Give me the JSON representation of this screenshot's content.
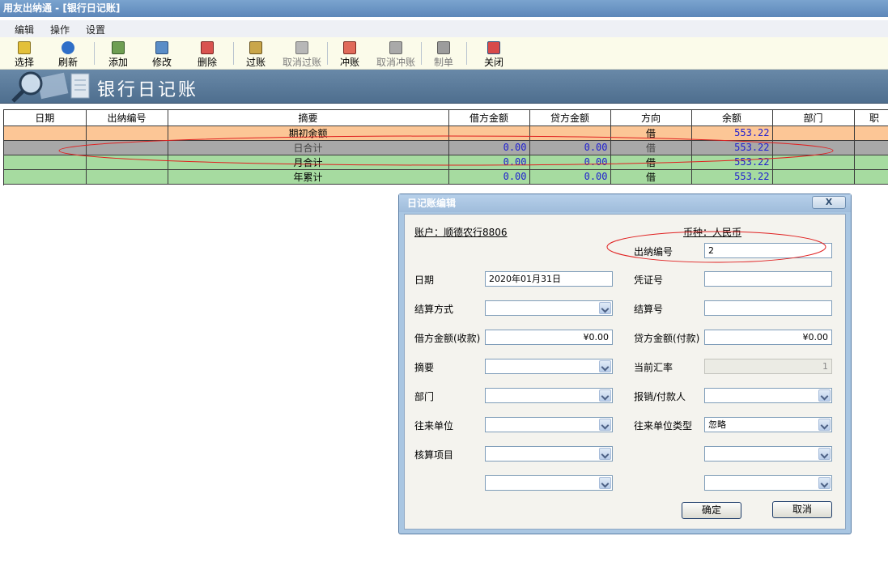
{
  "window": {
    "title": "用友出纳通 - [银行日记账]"
  },
  "menu": [
    "编辑",
    "操作",
    "设置"
  ],
  "toolbar": {
    "buttons": [
      {
        "label": "选择",
        "icon": "select-icon"
      },
      {
        "label": "刷新",
        "icon": "refresh-icon"
      },
      {
        "label": "添加",
        "icon": "add-icon"
      },
      {
        "label": "修改",
        "icon": "edit-icon"
      },
      {
        "label": "删除",
        "icon": "delete-icon"
      },
      {
        "label": "过账",
        "icon": "post-icon"
      },
      {
        "label": "取消过账",
        "icon": "unpost-icon"
      },
      {
        "label": "冲账",
        "icon": "reverse-icon"
      },
      {
        "label": "取消冲账",
        "icon": "unreverse-icon"
      },
      {
        "label": "制单",
        "icon": "voucher-icon"
      },
      {
        "label": "关闭",
        "icon": "close-window-icon"
      }
    ]
  },
  "banner": {
    "title": "银行日记账"
  },
  "grid": {
    "columns": [
      "日期",
      "出纳编号",
      "摘要",
      "借方金额",
      "贷方金额",
      "方向",
      "余额",
      "部门",
      "职"
    ],
    "rows": [
      {
        "summary": "期初余额",
        "debit": "",
        "credit": "",
        "direction": "借",
        "balance": "553.22",
        "bg": "#fcc696"
      },
      {
        "summary": "日合计",
        "debit": "0.00",
        "credit": "0.00",
        "direction": "借",
        "balance": "553.22",
        "bg": "#a8a8a8"
      },
      {
        "summary": "月合计",
        "debit": "0.00",
        "credit": "0.00",
        "direction": "借",
        "balance": "553.22",
        "bg": "#a6dba0"
      },
      {
        "summary": "年累计",
        "debit": "0.00",
        "credit": "0.00",
        "direction": "借",
        "balance": "553.22",
        "bg": "#a6dba0"
      }
    ]
  },
  "dialog": {
    "title": "日记账编辑",
    "close_label": "X",
    "account": "账户：顺德农行8806",
    "currency": "币种：人民币",
    "labels": {
      "cashier_no": "出纳编号",
      "date": "日期",
      "voucher_no": "凭证号",
      "settle_method": "结算方式",
      "settle_no": "结算号",
      "debit": "借方金额(收款)",
      "credit": "贷方金额(付款)",
      "summary": "摘要",
      "rate": "当前汇率",
      "department": "部门",
      "payee": "报销/付款人",
      "partner": "往来单位",
      "partner_type": "往来单位类型",
      "project": "核算项目"
    },
    "values": {
      "cashier_no": "2",
      "date": "2020年01月31日",
      "voucher_no": "",
      "settle_method": "",
      "settle_no": "",
      "debit": "¥0.00",
      "credit": "¥0.00",
      "summary": "",
      "rate": "1",
      "department": "",
      "payee": "",
      "partner": "",
      "partner_type": "忽略",
      "project": "",
      "extra_left": "",
      "extra_right1": "",
      "extra_right2": ""
    },
    "ok_label": "确定",
    "cancel_label": "取消"
  },
  "colors": {
    "highlight_ellipse": "#e02020",
    "grid_number": "#2020d0"
  }
}
